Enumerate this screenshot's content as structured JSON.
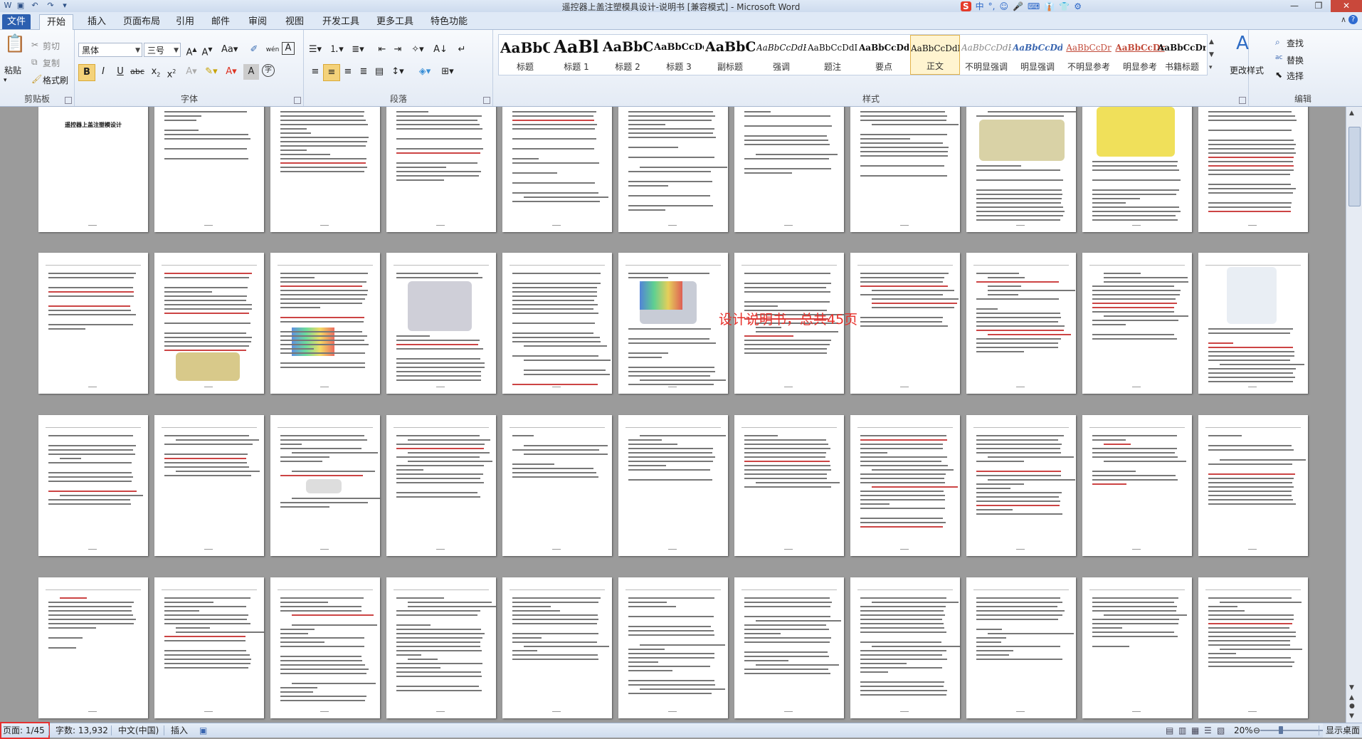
{
  "window": {
    "title": "遥控器上盖注塑模具设计-说明书 [兼容模式] - Microsoft Word",
    "ime": [
      "S",
      "中",
      "°,",
      "☺",
      "🎤",
      "⌨",
      "👔",
      "👕",
      "⚙"
    ]
  },
  "tabs": [
    "文件",
    "开始",
    "插入",
    "页面布局",
    "引用",
    "邮件",
    "审阅",
    "视图",
    "开发工具",
    "更多工具",
    "特色功能"
  ],
  "ribbon": {
    "clipboard": {
      "label": "剪贴板",
      "paste": "粘贴",
      "cut": "剪切",
      "copy": "复制",
      "format_painter": "格式刷"
    },
    "font": {
      "label": "字体",
      "font_name": "黑体",
      "font_size": "三号"
    },
    "paragraph": {
      "label": "段落"
    },
    "styles": {
      "label": "样式",
      "items": [
        {
          "preview": "AaBbC",
          "name": "标题"
        },
        {
          "preview": "AaBl",
          "name": "标题 1"
        },
        {
          "preview": "AaBbC",
          "name": "标题 2"
        },
        {
          "preview": "AaBbCcDd",
          "name": "标题 3"
        },
        {
          "preview": "AaBbC",
          "name": "副标题"
        },
        {
          "preview": "AaBbCcDdE",
          "name": "强调"
        },
        {
          "preview": "AaBbCcDdI",
          "name": "题注"
        },
        {
          "preview": "AaBbCcDdI",
          "name": "要点"
        },
        {
          "preview": "AaBbCcDdI",
          "name": "正文"
        },
        {
          "preview": "AaBbCcDdE",
          "name": "不明显强调"
        },
        {
          "preview": "AaBbCcDdI",
          "name": "明显强调"
        },
        {
          "preview": "AaBbCcDr",
          "name": "不明显参考"
        },
        {
          "preview": "AaBbCcDr",
          "name": "明显参考"
        },
        {
          "preview": "AaBbCcDr",
          "name": "书籍标题"
        }
      ],
      "selected_index": 8,
      "change_styles": "更改样式"
    },
    "editing": {
      "label": "编辑",
      "find": "查找",
      "replace": "替换",
      "select": "选择"
    }
  },
  "document": {
    "annotation": "设计说明书，总共45页",
    "page1_title": "遥控器上盖注塑模设计",
    "annotation_color": "#e8302a"
  },
  "statusbar": {
    "page": "页面: 1/45",
    "words": "字数: 13,932",
    "language": "中文(中国)",
    "mode": "插入",
    "zoom": "20%",
    "show_desktop": "显示桌面"
  }
}
